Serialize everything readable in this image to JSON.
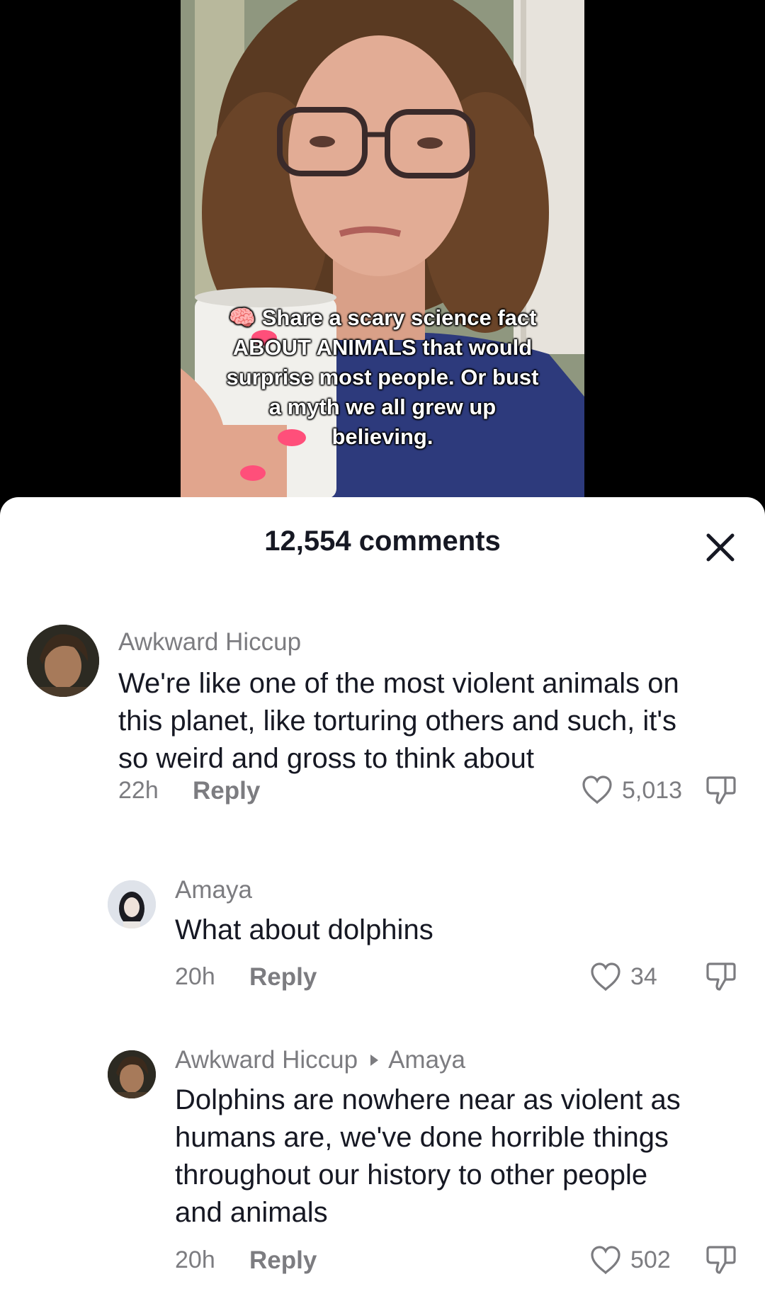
{
  "video": {
    "caption_lines": [
      "🧠 Share a scary science fact",
      "ABOUT ANIMALS that would",
      "surprise most people. Or bust",
      "a myth we all grew up",
      "believing."
    ]
  },
  "sheet": {
    "title": "12,554 comments",
    "close_icon": "close-icon"
  },
  "comments": [
    {
      "username": "Awkward Hiccup",
      "text_lines": [
        "We're like one of the most violent animals on",
        "this planet, like torturing others and such, it's",
        "so weird and gross to think about"
      ],
      "time": "22h",
      "reply_label": "Reply",
      "likes": "5,013"
    },
    {
      "username": "Amaya",
      "text_lines": [
        "What about dolphins"
      ],
      "time": "20h",
      "reply_label": "Reply",
      "likes": "34"
    },
    {
      "username": "Awkward Hiccup",
      "reply_to": "Amaya",
      "text_lines": [
        "Dolphins are nowhere near as violent as",
        "humans are, we've done horrible things",
        "throughout our history to other people",
        "and animals"
      ],
      "time": "20h",
      "reply_label": "Reply",
      "likes": "502"
    }
  ],
  "colors": {
    "text_primary": "#161823",
    "text_secondary": "#7c7c80",
    "sheet_bg": "#ffffff"
  }
}
